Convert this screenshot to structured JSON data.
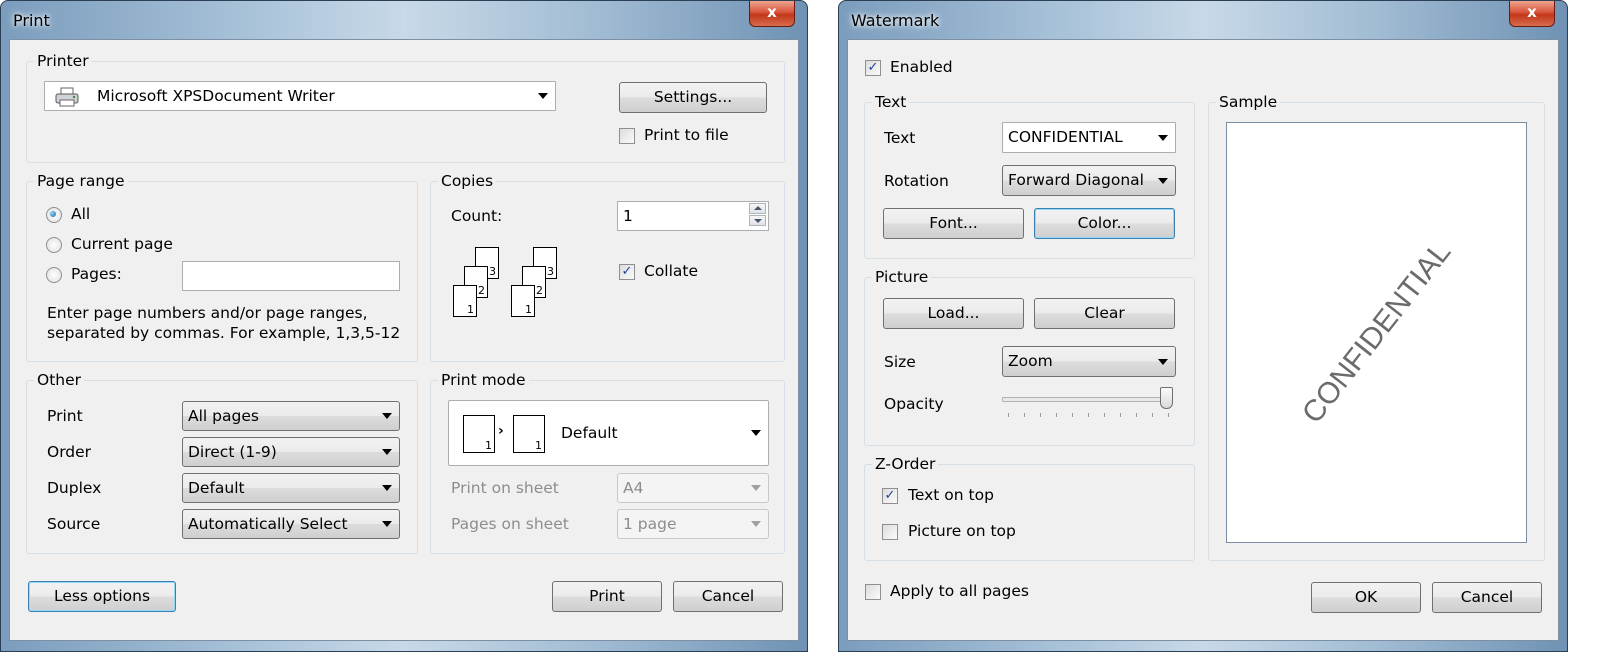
{
  "print_dialog": {
    "title": "Print",
    "close_glyph": "x",
    "printer": {
      "group_label": "Printer",
      "selected_printer": "Microsoft XPSDocument Writer",
      "printer_icon": "printer-icon",
      "settings_label": "Settings...",
      "print_to_file_label": "Print to file",
      "print_to_file_checked": false
    },
    "page_range": {
      "group_label": "Page range",
      "options": [
        "All",
        "Current page",
        "Pages:"
      ],
      "selected": "All",
      "pages_value": "",
      "hint_line1": "Enter page numbers and/or page ranges,",
      "hint_line2": "separated by commas. For example, 1,3,5-12"
    },
    "copies": {
      "group_label": "Copies",
      "count_label": "Count:",
      "count_value": "1",
      "collate_label": "Collate",
      "collate_checked": true,
      "page_numbers": [
        "1",
        "2",
        "3"
      ]
    },
    "other": {
      "group_label": "Other",
      "rows": [
        {
          "label": "Print",
          "value": "All pages"
        },
        {
          "label": "Order",
          "value": "Direct (1-9)"
        },
        {
          "label": "Duplex",
          "value": "Default"
        },
        {
          "label": "Source",
          "value": "Automatically Select"
        }
      ]
    },
    "print_mode": {
      "group_label": "Print mode",
      "mode_value": "Default",
      "mode_icon_numbers": [
        "1",
        "1"
      ],
      "print_on_sheet_label": "Print on sheet",
      "print_on_sheet_value": "A4",
      "pages_on_sheet_label": "Pages on sheet",
      "pages_on_sheet_value": "1 page"
    },
    "buttons": {
      "less_options": "Less options",
      "print": "Print",
      "cancel": "Cancel"
    }
  },
  "watermark_dialog": {
    "title": "Watermark",
    "close_glyph": "x",
    "enabled_label": "Enabled",
    "enabled_checked": true,
    "text_group": {
      "group_label": "Text",
      "text_label": "Text",
      "text_value": "CONFIDENTIAL",
      "rotation_label": "Rotation",
      "rotation_value": "Forward Diagonal",
      "font_button": "Font...",
      "color_button": "Color..."
    },
    "picture_group": {
      "group_label": "Picture",
      "load_button": "Load...",
      "clear_button": "Clear",
      "size_label": "Size",
      "size_value": "Zoom",
      "opacity_label": "Opacity",
      "opacity_fraction": 1.0
    },
    "zorder_group": {
      "group_label": "Z-Order",
      "text_on_top_label": "Text on top",
      "text_on_top_checked": true,
      "picture_on_top_label": "Picture on top",
      "picture_on_top_checked": false
    },
    "sample_group": {
      "group_label": "Sample",
      "watermark_text": "CONFIDENTIAL"
    },
    "apply_all_label": "Apply to all pages",
    "apply_all_checked": false,
    "buttons": {
      "ok": "OK",
      "cancel": "Cancel"
    }
  }
}
